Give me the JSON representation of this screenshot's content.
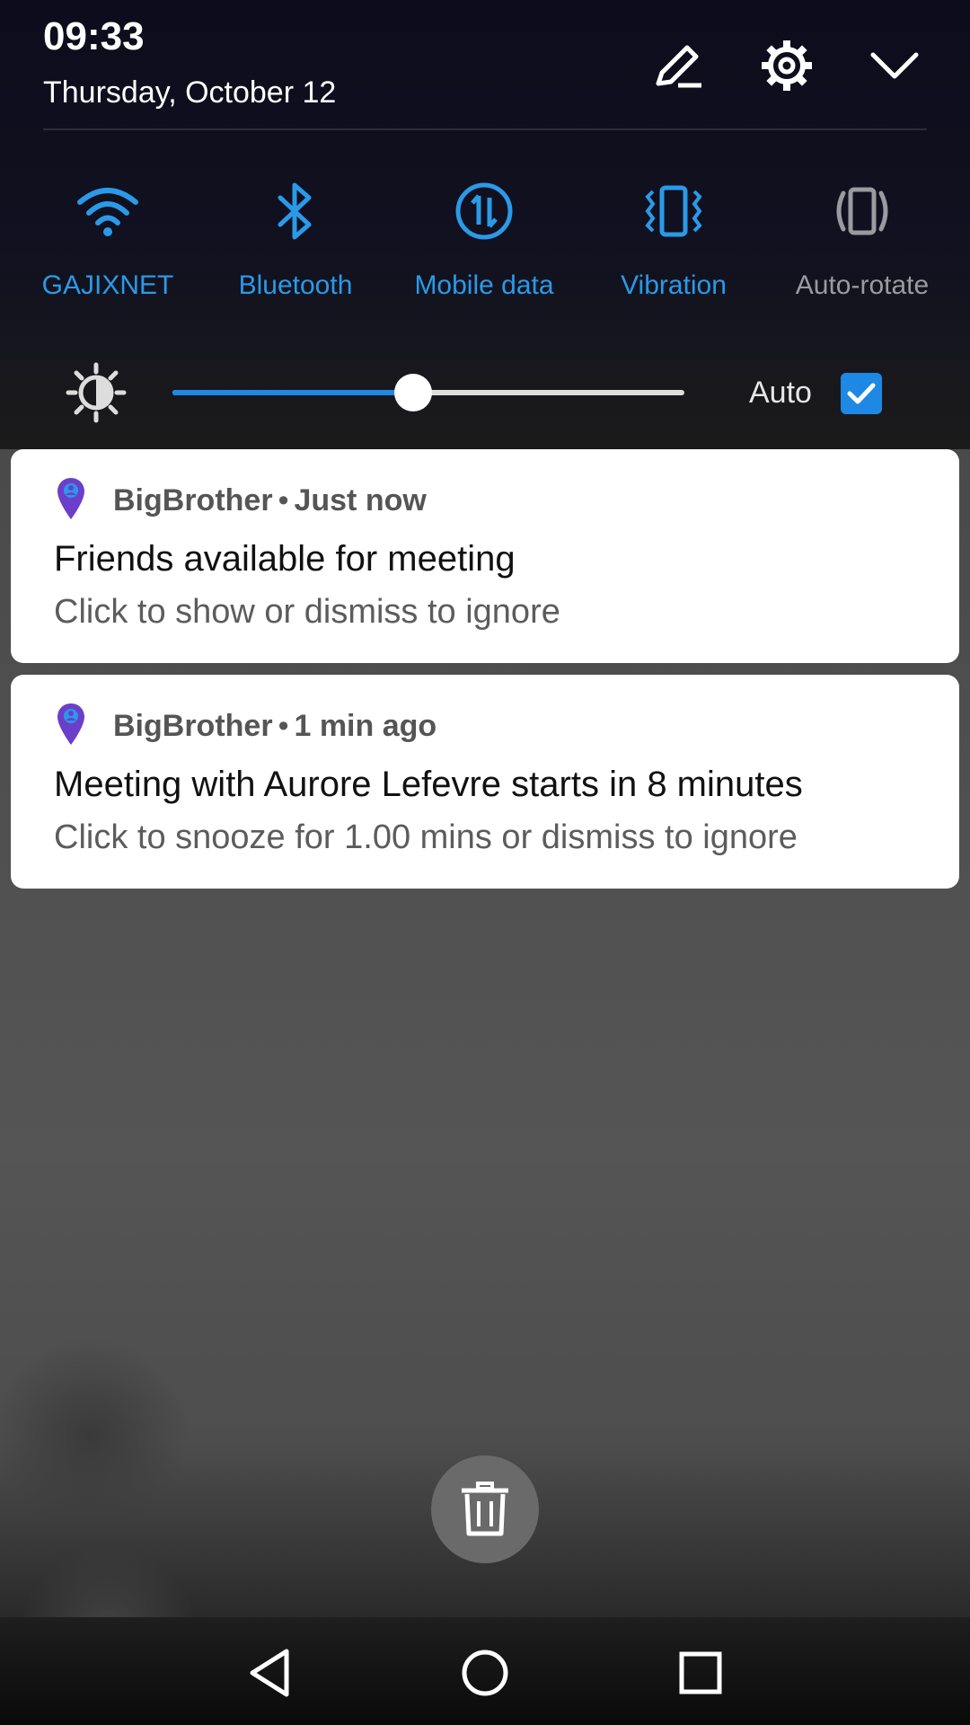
{
  "status": {
    "time": "09:33",
    "date": "Thursday, October 12"
  },
  "header_buttons": [
    {
      "name": "edit-icon"
    },
    {
      "name": "settings-gear-icon"
    },
    {
      "name": "collapse-chevron-icon"
    }
  ],
  "quick_settings": [
    {
      "label": "GAJIXNET",
      "icon": "wifi-icon",
      "active": true
    },
    {
      "label": "Bluetooth",
      "icon": "bluetooth-icon",
      "active": true
    },
    {
      "label": "Mobile data",
      "icon": "mobile-data-icon",
      "active": true
    },
    {
      "label": "Vibration",
      "icon": "vibration-icon",
      "active": true
    },
    {
      "label": "Auto-rotate",
      "icon": "auto-rotate-icon",
      "active": false
    }
  ],
  "brightness": {
    "level_percent": 47,
    "auto_label": "Auto",
    "auto_checked": true
  },
  "notifications": [
    {
      "app": "BigBrother",
      "time": "Just now",
      "title": "Friends available for meeting",
      "body": "Click to show or dismiss to ignore"
    },
    {
      "app": "BigBrother",
      "time": "1 min ago",
      "title": "Meeting with Aurore Lefevre starts in 8 minutes",
      "body": "Click to snooze for 1.00 mins or dismiss to ignore"
    }
  ],
  "colors": {
    "accent": "#2a9ae8",
    "app_icon": "#6b3fc9",
    "panel_bg": "#0c0c1c"
  }
}
